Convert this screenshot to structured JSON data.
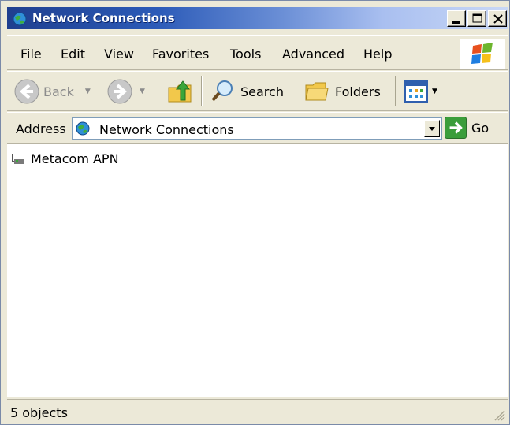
{
  "window": {
    "title": "Network Connections",
    "icon": "network-connections-icon"
  },
  "menubar": {
    "items": [
      "File",
      "Edit",
      "View",
      "Favorites",
      "Tools",
      "Advanced",
      "Help"
    ]
  },
  "toolbar": {
    "back_label": "Back",
    "search_label": "Search",
    "folders_label": "Folders"
  },
  "address": {
    "label": "Address",
    "value": "Network Connections",
    "go_label": "Go"
  },
  "content": {
    "items": [
      {
        "label": "Metacom APN",
        "icon": "dialup-connection-icon"
      }
    ]
  },
  "statusbar": {
    "text": "5 objects"
  },
  "colors": {
    "title_gradient_start": "#1f3f8f",
    "title_gradient_end": "#c9d8f6",
    "chrome": "#ece9d8",
    "go_green": "#3a9d3a"
  }
}
